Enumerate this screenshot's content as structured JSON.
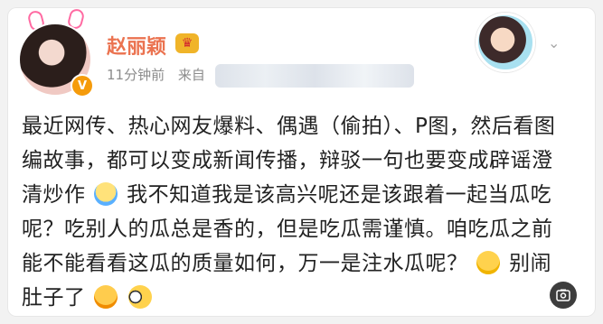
{
  "post": {
    "author_name": "赵丽颖",
    "time": "11分钟前",
    "source_label": "来自",
    "verify_badge": "V",
    "content_segments": [
      "最近网传、热心网友爆料、偶遇（偷拍）、P图，然后看图编故事，都可以变成新闻传播，辩驳一句也要变成辟谣澄清炒作",
      "我不知道我是该高兴呢还是该跟着一起当瓜吃呢？吃别人的瓜总是香的，但是吃瓜需谨慎。咱吃瓜之前能不能看看这瓜的质量如何，万一是注水瓜呢？",
      "别闹肚子了"
    ]
  },
  "icons": {
    "menu": "chevron-down-icon",
    "crown": "crown-icon",
    "photo": "photo-icon"
  },
  "colors": {
    "name": "#eb7350",
    "meta": "#8c8c8c",
    "background": "#f2f2f2"
  }
}
